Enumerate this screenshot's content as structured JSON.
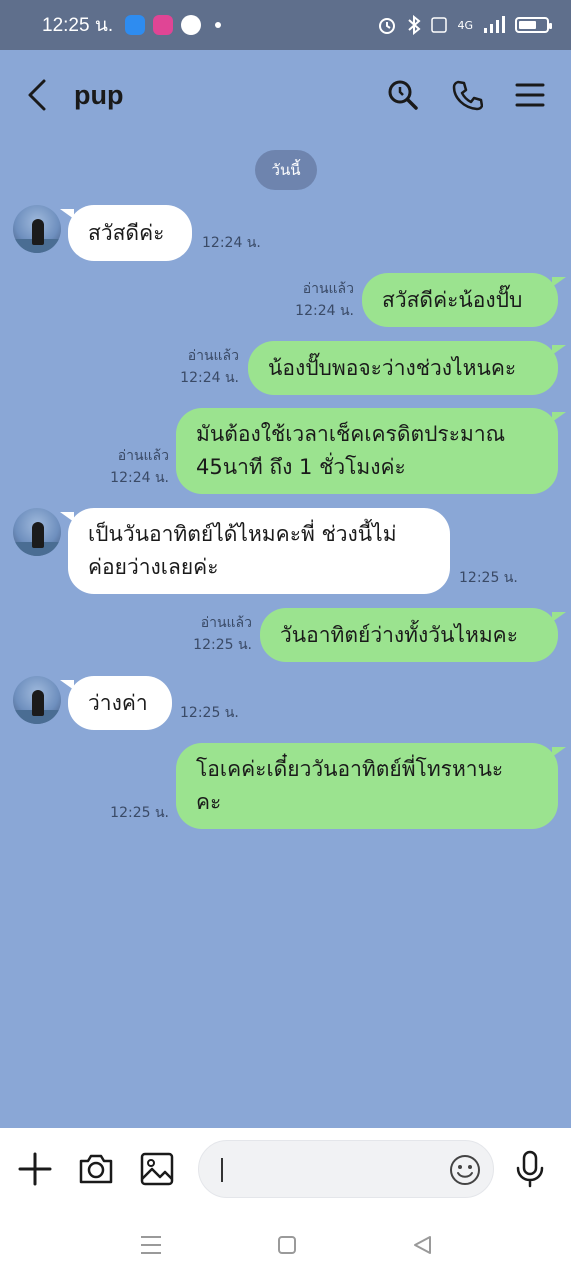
{
  "status_bar": {
    "time": "12:25 น.",
    "network_label": "4G",
    "battery_level": 0.65
  },
  "header": {
    "title": "pup"
  },
  "date_chip": "วันนี้",
  "messages": [
    {
      "side": "in",
      "text": "สวัสดีค่ะ",
      "time": "12:24 น."
    },
    {
      "side": "out",
      "text": "สวัสดีค่ะน้องปั๊บ",
      "read": "อ่านแล้ว",
      "time": "12:24 น."
    },
    {
      "side": "out",
      "text": "น้องปั๊บพอจะว่างช่วงไหนคะ",
      "read": "อ่านแล้ว",
      "time": "12:24 น."
    },
    {
      "side": "out",
      "text_lines": [
        "มันต้องใช้เวลาเช็คเครดิตประมาณ",
        "45นาที ถึง 1 ชั่วโมงค่ะ"
      ],
      "read": "อ่านแล้ว",
      "time": "12:24 น."
    },
    {
      "side": "in",
      "text_lines": [
        "เป็นวันอาทิตย์ได้ไหมคะพี่ ช่วงนี้ไม่",
        "ค่อยว่างเลยค่ะ"
      ],
      "time": "12:25 น."
    },
    {
      "side": "out",
      "text": "วันอาทิตย์ว่างทั้งวันไหมคะ",
      "read": "อ่านแล้ว",
      "time": "12:25 น."
    },
    {
      "side": "in",
      "text": "ว่างค่า",
      "time": "12:25 น."
    },
    {
      "side": "out",
      "text_lines": [
        "โอเคค่ะเดี๋ยววันอาทิตย์พี่โทรหานะ",
        "คะ"
      ],
      "time": "12:25 น."
    }
  ],
  "colors": {
    "chat_background": "#8aa7d6",
    "outgoing_bubble": "#9be38f",
    "incoming_bubble": "#ffffff",
    "status_bar": "#5f6f8c"
  },
  "icons": {
    "back": "back-arrow-icon",
    "search": "search-icon",
    "call": "phone-icon",
    "menu": "menu-icon",
    "add": "plus-icon",
    "camera": "camera-icon",
    "gallery": "image-icon",
    "emoji": "emoji-icon",
    "mic": "microphone-icon"
  }
}
